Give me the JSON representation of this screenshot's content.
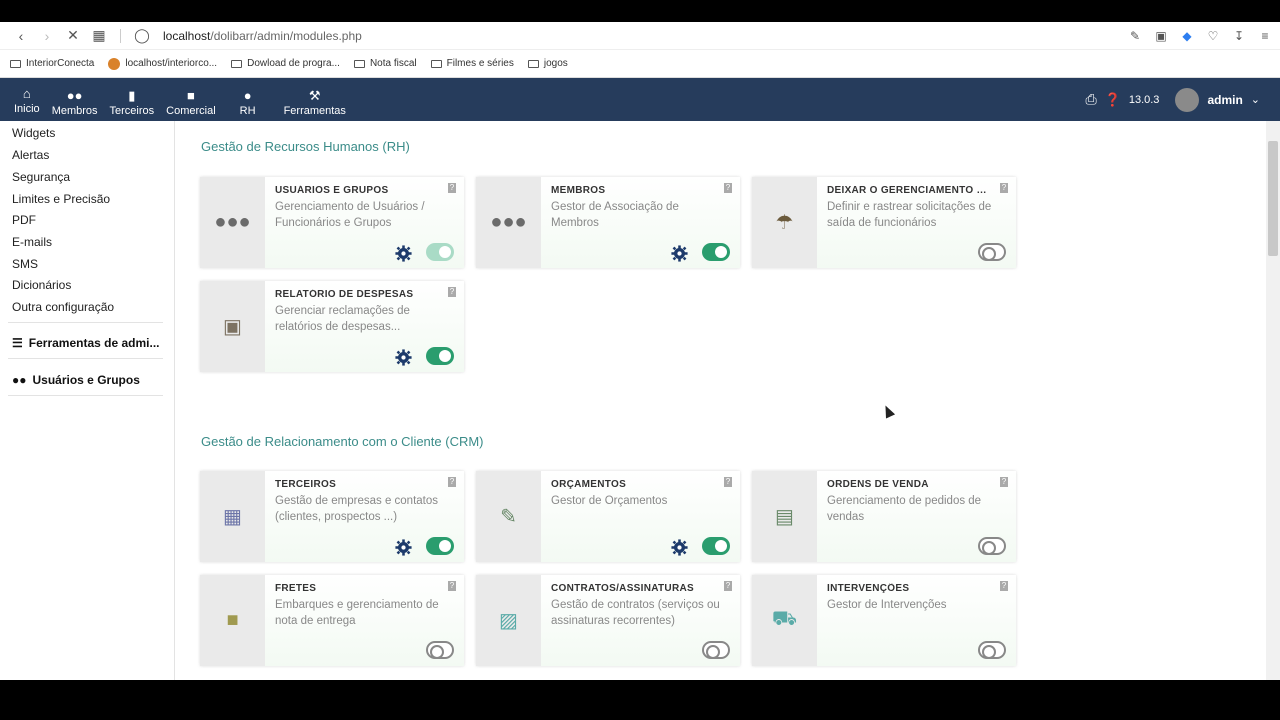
{
  "browser": {
    "url_host": "localhost",
    "url_path": "/dolibarr/admin/modules.php",
    "bookmarks": [
      "InteriorConecta",
      "localhost/interiorco...",
      "Dowload de progra...",
      "Nota fiscal",
      "Filmes e séries",
      "jogos"
    ]
  },
  "topmenu": {
    "items": [
      {
        "label": "Inicio",
        "icon": "home-icon"
      },
      {
        "label": "Membros",
        "icon": "users-icon"
      },
      {
        "label": "Terceiros",
        "icon": "building-icon"
      },
      {
        "label": "Comercial",
        "icon": "briefcase-icon"
      },
      {
        "label": "RH",
        "icon": "person-icon"
      },
      {
        "label": "Ferramentas",
        "icon": "wrench-icon"
      }
    ],
    "version": "13.0.3",
    "user": "admin"
  },
  "sidebar": {
    "links": [
      "Widgets",
      "Alertas",
      "Segurança",
      "Limites e Precisão",
      "PDF",
      "E-mails",
      "SMS",
      "Dicionários",
      "Outra configuração"
    ],
    "tools_heading": "Ferramentas de admi...",
    "users_heading": "Usuários e Grupos"
  },
  "sections": [
    {
      "title": "Gestão de Recursos Humanos (RH)",
      "cards": [
        {
          "title": "USUÁRIOS E GRUPOS",
          "desc": "Gerenciamento de Usuários / Funcionários e Grupos",
          "icon": "users-icon",
          "enabled": true
        },
        {
          "title": "MEMBROS",
          "desc": "Gestor de Associação de Membros",
          "icon": "users-icon",
          "enabled": true
        },
        {
          "title": "DEIXAR O GERENCIAMENTO D...",
          "desc": "Definir e rastrear solicitações de saída de funcionários",
          "icon": "beach-umbrella-icon",
          "enabled": false
        },
        {
          "title": "RELATÓRIO DE DESPESAS",
          "desc": "Gerenciar reclamações de relatórios de despesas...",
          "icon": "wallet-icon",
          "enabled": true
        }
      ]
    },
    {
      "title": "Gestão de Relacionamento com o Cliente (CRM)",
      "cards": [
        {
          "title": "TERCEIROS",
          "desc": "Gestão de empresas e contatos (clientes, prospectos ...)",
          "icon": "building-icon",
          "enabled": true
        },
        {
          "title": "ORÇAMENTOS",
          "desc": "Gestor de Orçamentos",
          "icon": "file-signature-icon",
          "enabled": true
        },
        {
          "title": "ORDENS DE VENDA",
          "desc": "Gerenciamento de pedidos de vendas",
          "icon": "file-icon",
          "enabled": false
        },
        {
          "title": "FRETES",
          "desc": "Embarques e gerenciamento de nota de entrega",
          "icon": "dolly-icon",
          "enabled": false
        },
        {
          "title": "CONTRATOS/ASSINATURAS",
          "desc": "Gestão de contratos (serviços ou assinaturas recorrentes)",
          "icon": "suitcase-icon",
          "enabled": false
        },
        {
          "title": "INTERVENÇÕES",
          "desc": "Gestor de Intervenções",
          "icon": "truck-medical-icon",
          "enabled": false
        }
      ]
    }
  ],
  "colors": {
    "topbar": "#263c5c",
    "accent": "#3b8c89",
    "toggle_on": "#2a9d6e"
  }
}
